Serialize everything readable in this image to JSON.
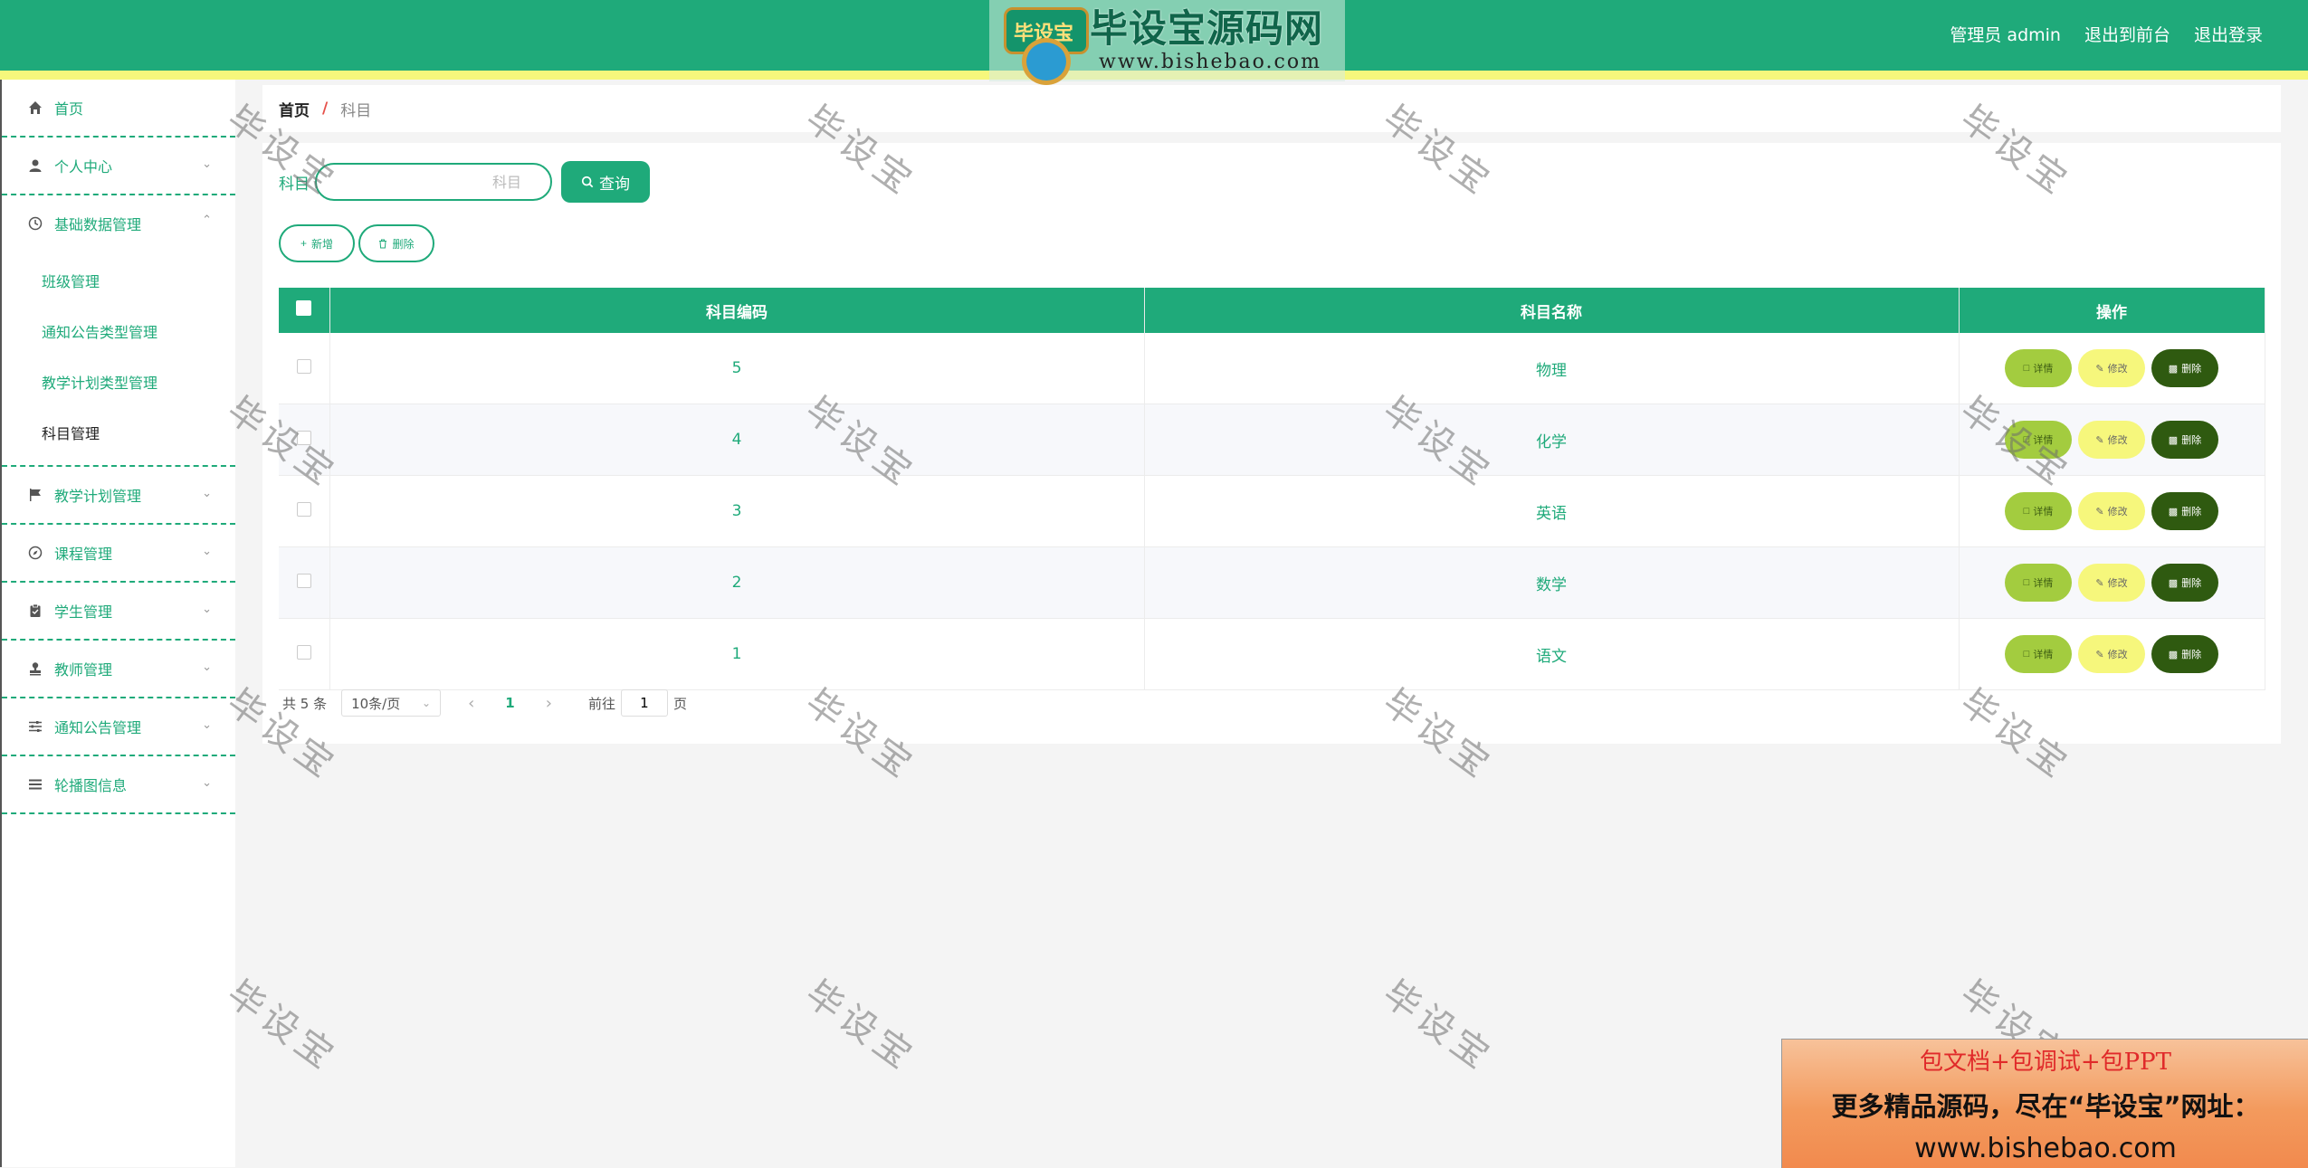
{
  "header": {
    "logo_text": "毕设宝源码网",
    "logo_badge": "毕设宝",
    "logo_url": "www.bishebao.com",
    "user_label": "管理员 admin",
    "to_frontend": "退出到前台",
    "logout": "退出登录",
    "accent_color": "#1faa7a"
  },
  "sidebar": {
    "home": "首页",
    "personal": "个人中心",
    "basic": "基础数据管理",
    "basic_sub": [
      "班级管理",
      "通知公告类型管理",
      "教学计划类型管理",
      "科目管理"
    ],
    "teaching_plan": "教学计划管理",
    "course": "课程管理",
    "student": "学生管理",
    "teacher": "教师管理",
    "notice": "通知公告管理",
    "carousel": "轮播图信息"
  },
  "breadcrumb": {
    "home": "首页",
    "sep": "/",
    "current": "科目"
  },
  "search": {
    "label": "科目",
    "placeholder": "科目",
    "button": "查询"
  },
  "actions": {
    "add": "新增",
    "delete": "删除"
  },
  "table": {
    "headers": [
      "科目编码",
      "科目名称",
      "操作"
    ],
    "rows": [
      {
        "code": "5",
        "name": "物理"
      },
      {
        "code": "4",
        "name": "化学"
      },
      {
        "code": "3",
        "name": "英语"
      },
      {
        "code": "2",
        "name": "数学"
      },
      {
        "code": "1",
        "name": "语文"
      }
    ],
    "row_buttons": {
      "detail": "详情",
      "edit": "修改",
      "delete": "删除"
    }
  },
  "pager": {
    "total": "共 5 条",
    "size": "10条/页",
    "current": "1",
    "goto_prefix": "前往",
    "goto_value": "1",
    "goto_suffix": "页"
  },
  "watermark": "毕设宝",
  "ad": {
    "line1": "包文档+包调试+包PPT",
    "line2": "更多精品源码，尽在“毕设宝”网址：",
    "line3": "www.bishebao.com"
  }
}
